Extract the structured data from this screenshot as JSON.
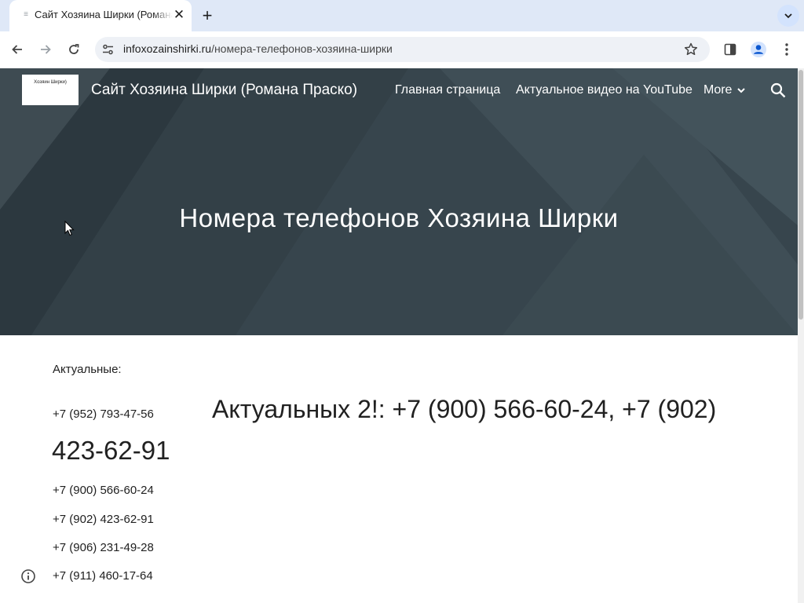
{
  "browser": {
    "tab": {
      "title": "Сайт Хозяина Ширки (Романа Праско)"
    },
    "omnibox": {
      "host": "infoxozainshirki.ru",
      "path": "/номера-телефонов-хозяина-ширки"
    }
  },
  "site": {
    "logo_text": "Хозяин Ширки)",
    "title": "Сайт Хозяина Ширки (Романа Праско)",
    "nav": [
      "Главная страница",
      "Актуальное видео на YouTube",
      "More"
    ],
    "hero_title": "Номера телефонов Хозяина Ширки"
  },
  "content": {
    "label": "Актуальные:",
    "phone_first": "+7 (952) 793-47-56",
    "big_number": "423-62-91",
    "phones": [
      "+7 (900) 566-60-24",
      "+7 (902) 423-62-91",
      "+7 (906) 231-49-28",
      "+7 (911) 460-17-64"
    ],
    "heading": "Актуальных 2!: +7 (900) 566-60-24, +7 (902)"
  },
  "colors": {
    "hero_bg": "#3d4b53",
    "tabstrip_bg": "#dfe8f7",
    "accent": "#0b57d0"
  }
}
